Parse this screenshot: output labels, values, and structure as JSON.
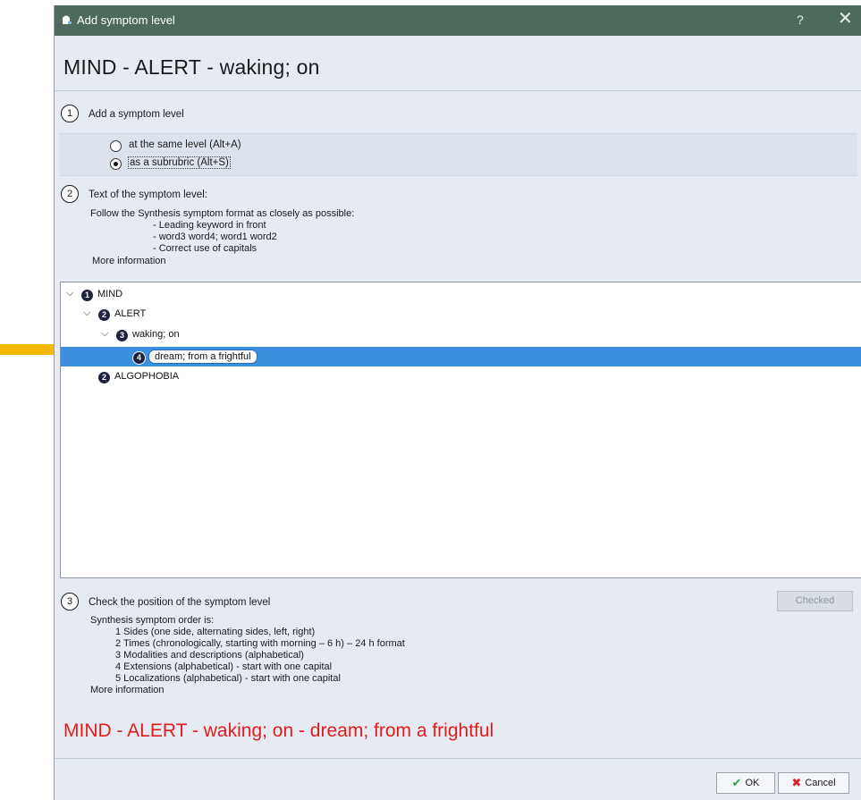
{
  "window": {
    "title": "Add symptom level",
    "help": "?",
    "close": "✕"
  },
  "heading": "MIND - ALERT - waking; on",
  "step1": {
    "number": "1",
    "label": "Add a symptom level",
    "options": [
      {
        "label": "at the same level  (Alt+A)",
        "selected": false
      },
      {
        "label": "as a subrubric (Alt+S)",
        "selected": true
      }
    ]
  },
  "step2": {
    "number": "2",
    "label": "Text of the symptom level:",
    "instruction": "Follow the Synthesis symptom format as closely as possible:",
    "bullets": [
      "- Leading keyword in front",
      "- word3 word4; word1 word2",
      "- Correct use of capitals"
    ],
    "more_info": "More information"
  },
  "tree": [
    {
      "level": "1",
      "label": "MIND",
      "expanded": true
    },
    {
      "level": "2",
      "label": "ALERT",
      "expanded": true
    },
    {
      "level": "3",
      "label": "waking; on",
      "expanded": true
    },
    {
      "level": "4",
      "label": "dream; from a frightful",
      "editing": true
    },
    {
      "level": "2",
      "label": "ALGOPHOBIA"
    }
  ],
  "step3": {
    "number": "3",
    "label": "Check the position of the symptom level",
    "checked_button": "Checked",
    "order_title": "Synthesis symptom order is:",
    "order_items": [
      "1 Sides (one side, alternating sides, left, right)",
      "2 Times (chronologically, starting with morning – 6 h) – 24 h format",
      "3 Modalities and descriptions (alphabetical)",
      "4 Extensions (alphabetical) - start with one capital",
      "5 Localizations (alphabetical) - start with one capital"
    ],
    "more_info": "More information"
  },
  "result_text": "MIND - ALERT - waking; on - dream; from a frightful",
  "buttons": {
    "ok": "OK",
    "cancel": "Cancel"
  },
  "colors": {
    "titlebar": "#4d6a5c",
    "selection": "#3c8fde",
    "result": "#e41b1b",
    "arrow": "#f5b800",
    "badge": "#1e2240"
  }
}
